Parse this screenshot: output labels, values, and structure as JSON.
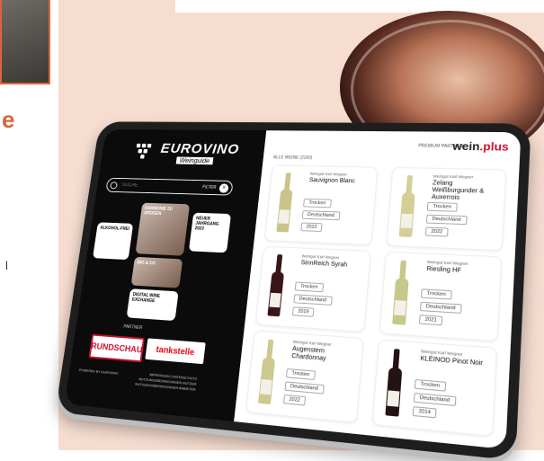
{
  "page": {
    "side_letter": "e",
    "side_char": "l"
  },
  "brand": {
    "name": "EUROVINO",
    "subtitle": "Weinguide"
  },
  "search": {
    "placeholder": "SUCHE",
    "filter_label": "FILTER"
  },
  "categories": [
    {
      "label": "HARMONIE ZU SPEISEN"
    },
    {
      "label": "ALKOHOL-FREI"
    },
    {
      "label": "NEUER JAHRGANG 2023"
    },
    {
      "label": "BIO & CO"
    },
    {
      "label": "DIGITAL WINE EXCHANGE"
    }
  ],
  "partner": {
    "label": "PARTNER",
    "logos": [
      "RUNDSCHAU",
      "tankstelle"
    ]
  },
  "footer": {
    "powered": "POWERED BY EUROVINO",
    "links": [
      "IMPRESSUM | DATENSCHUTZ",
      "NUTZUNGSBEDINGUNGEN NUTZER",
      "NUTZUNGSBEDINGUNGEN ANBIETER"
    ]
  },
  "header": {
    "premium_label": "PREMIUM PARTNER",
    "partner_logo_a": "wein",
    "partner_logo_b": ".plus",
    "count": "ALLE WEINE (2160)"
  },
  "wines": [
    {
      "producer": "Weingut Karl Wegner",
      "name": "Sauvignon Blanc",
      "style": "Trocken",
      "country": "Deutschland",
      "year": "2022",
      "bottle_color": "#c9c58a"
    },
    {
      "producer": "Weingut Karl Wegner",
      "name": "Zelang Weißburgunder & Auxerrois",
      "style": "Trocken",
      "country": "Deutschland",
      "year": "2022",
      "bottle_color": "#d4cf96"
    },
    {
      "producer": "Weingut Karl Wegner",
      "name": "SinnReich Syrah",
      "style": "Trocken",
      "country": "Deutschland",
      "year": "2019",
      "bottle_color": "#3a1518"
    },
    {
      "producer": "Weingut Karl Wegner",
      "name": "Riesling HF",
      "style": "Trocken",
      "country": "Deutschland",
      "year": "2021",
      "bottle_color": "#c6c88c"
    },
    {
      "producer": "Weingut Karl Wegner",
      "name": "Augenstern Chardonnay",
      "style": "Trocken",
      "country": "Deutschland",
      "year": "2022",
      "bottle_color": "#cdc990"
    },
    {
      "producer": "Weingut Karl Wegner",
      "name": "KLEINOD Pinot Noir",
      "style": "Trocken",
      "country": "Deutschland",
      "year": "2014",
      "bottle_color": "#241314"
    }
  ]
}
